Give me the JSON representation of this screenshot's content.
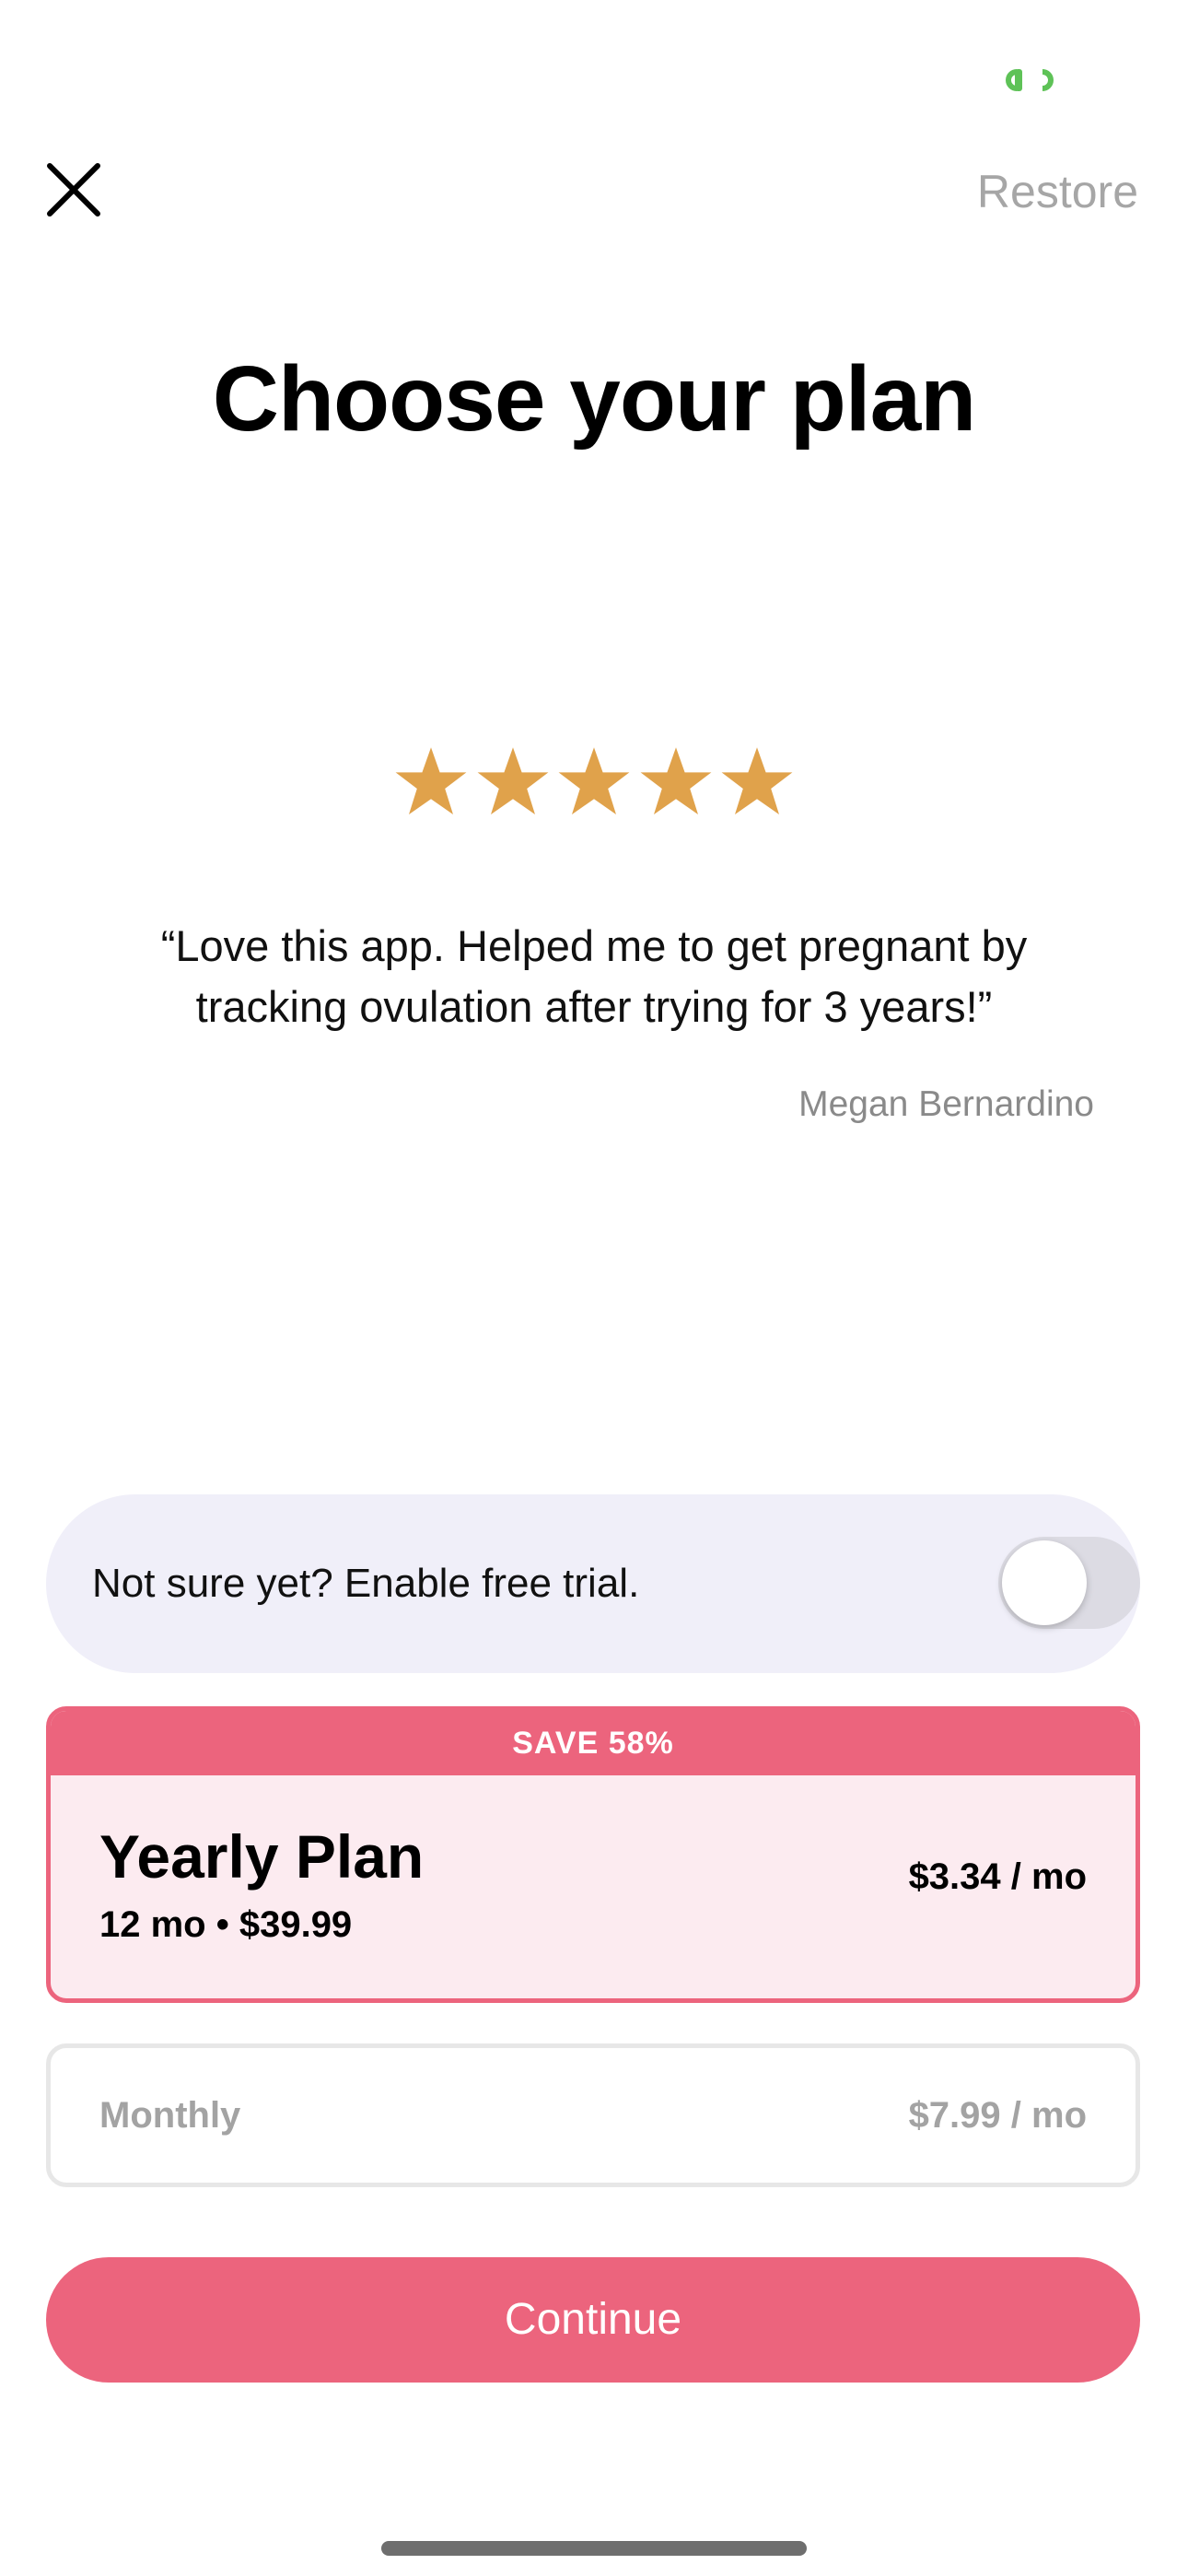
{
  "colors": {
    "accent": "#ec647d",
    "selected_card_bg": "#fcebf0",
    "trial_card_bg": "#f0eff9",
    "star": "#e0a24b",
    "muted_text": "#a6a6a6",
    "status_indicator": "#5ec257"
  },
  "header": {
    "close_icon": "close-icon",
    "restore_label": "Restore"
  },
  "title": "Choose your plan",
  "testimonial": {
    "rating": 5,
    "rating_max": 5,
    "star_icon": "star-icon",
    "quote": "“Love this app. Helped me to get pregnant by tracking ovulation after trying for 3 years!”",
    "author": "Megan Bernardino"
  },
  "free_trial": {
    "label": "Not sure yet? Enable free trial.",
    "enabled": false
  },
  "plans": {
    "yearly": {
      "badge": "SAVE 58%",
      "name": "Yearly Plan",
      "details": "12 mo • $39.99",
      "per_month": "$3.34 / mo",
      "selected": true
    },
    "monthly": {
      "name": "Monthly",
      "per_month": "$7.99 / mo",
      "selected": false
    }
  },
  "continue_label": "Continue"
}
